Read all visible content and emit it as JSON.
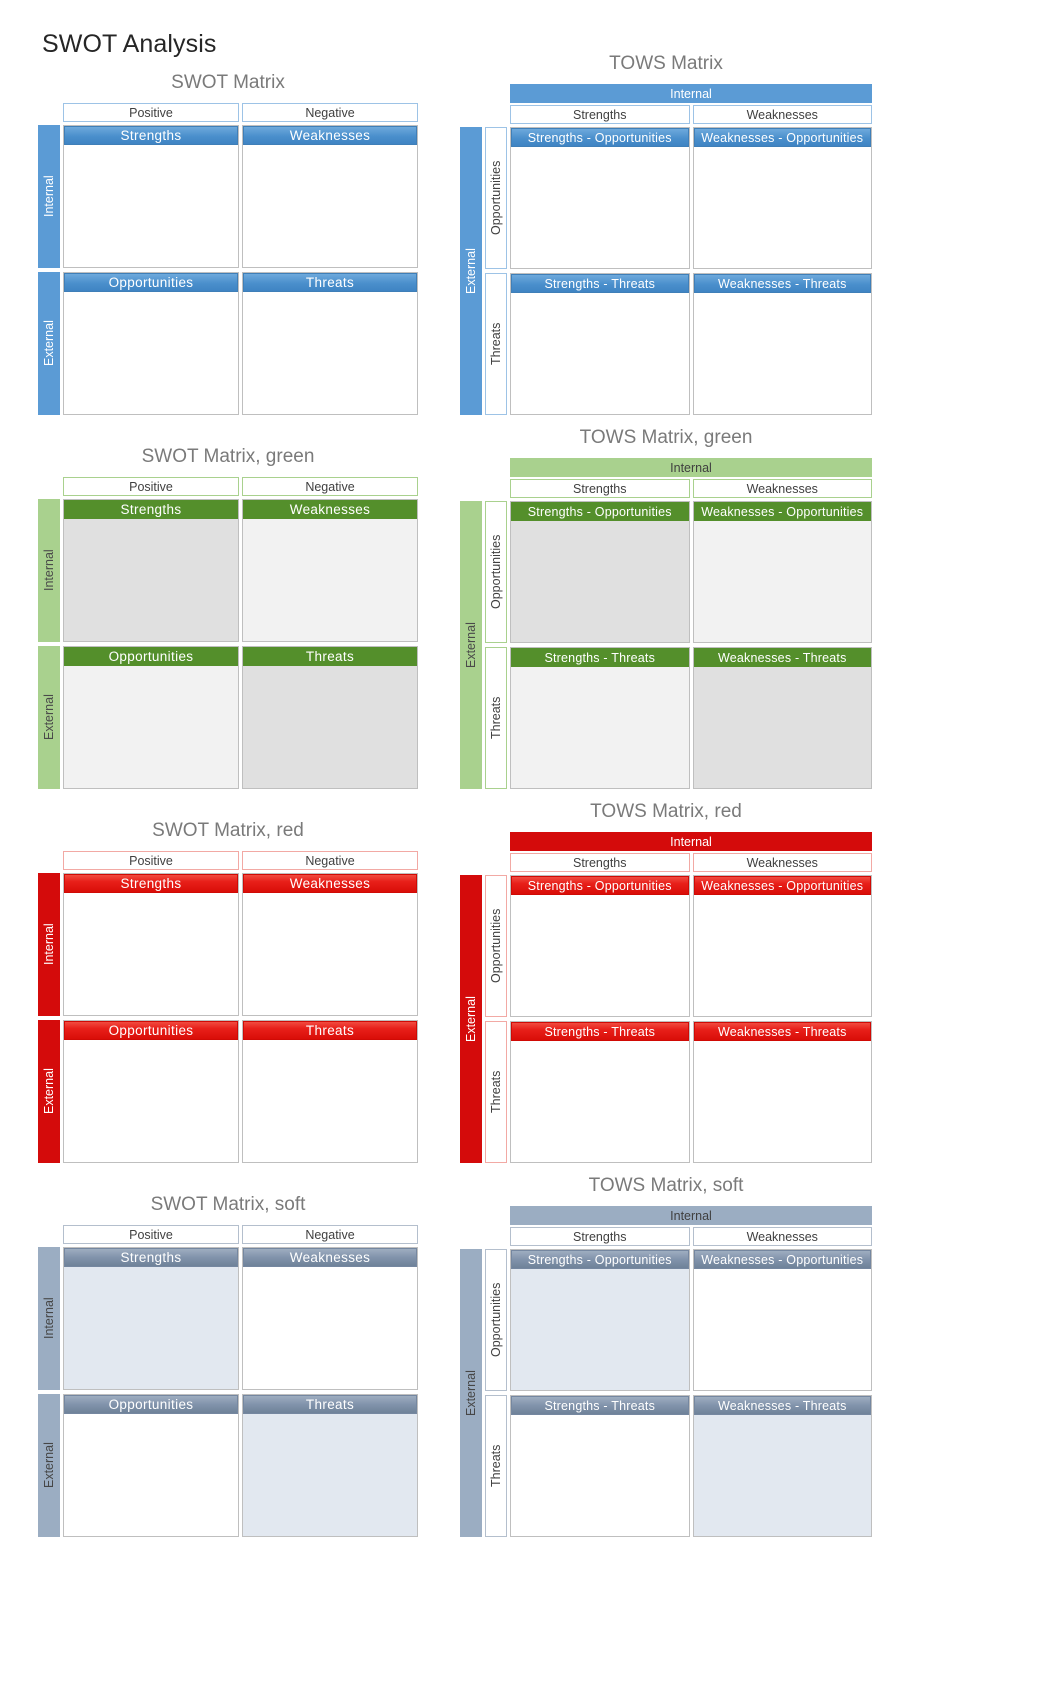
{
  "page": {
    "title": "SWOT Analysis"
  },
  "labels": {
    "positive": "Positive",
    "negative": "Negative",
    "internal": "Internal",
    "external": "External",
    "strengths": "Strengths",
    "weaknesses": "Weaknesses",
    "opportunities": "Opportunities",
    "threats": "Threats",
    "so": "Strengths - Opportunities",
    "wo": "Weaknesses - Opportunities",
    "st": "Strengths - Threats",
    "wt": "Weaknesses - Threats"
  },
  "colors": {
    "blue_accent": "#5B9BD5",
    "blue_header": "#3F84C3",
    "blue_border": "#9DC3E6",
    "green_accent": "#A9D18E",
    "green_header": "#548F2B",
    "red_accent": "#D40B0B",
    "red_header": "#E8201A",
    "soft_accent": "#9BADC2",
    "soft_header": "#8193AB",
    "fill_dark": "#E0E0E0",
    "fill_light": "#F2F2F2",
    "fill_soft": "#E2E8F0",
    "title_gray": "#7A7A7A",
    "text_gray": "#404040"
  },
  "matrices": {
    "swot_blue": {
      "title": "SWOT Matrix",
      "theme": "blue",
      "col_headers": [
        "Positive",
        "Negative"
      ],
      "row_headers": [
        "Internal",
        "External"
      ],
      "quadrants": [
        {
          "label": "Strengths",
          "fill": "none"
        },
        {
          "label": "Weaknesses",
          "fill": "none"
        },
        {
          "label": "Opportunities",
          "fill": "none"
        },
        {
          "label": "Threats",
          "fill": "none"
        }
      ]
    },
    "tows_blue": {
      "title": "TOWS Matrix",
      "theme": "blue",
      "top_bar": "Internal",
      "col_headers": [
        "Strengths",
        "Weaknesses"
      ],
      "outer_row_header": "External",
      "inner_row_headers": [
        "Opportunities",
        "Threats"
      ],
      "quadrants": [
        {
          "label": "Strengths - Opportunities",
          "fill": "none"
        },
        {
          "label": "Weaknesses - Opportunities",
          "fill": "none"
        },
        {
          "label": "Strengths - Threats",
          "fill": "none"
        },
        {
          "label": "Weaknesses - Threats",
          "fill": "none"
        }
      ]
    },
    "swot_green": {
      "title": "SWOT Matrix, green",
      "theme": "green",
      "col_headers": [
        "Positive",
        "Negative"
      ],
      "row_headers": [
        "Internal",
        "External"
      ],
      "quadrants": [
        {
          "label": "Strengths",
          "fill": "dark"
        },
        {
          "label": "Weaknesses",
          "fill": "light"
        },
        {
          "label": "Opportunities",
          "fill": "light"
        },
        {
          "label": "Threats",
          "fill": "dark"
        }
      ]
    },
    "tows_green": {
      "title": "TOWS Matrix, green",
      "theme": "green",
      "top_bar": "Internal",
      "col_headers": [
        "Strengths",
        "Weaknesses"
      ],
      "outer_row_header": "External",
      "inner_row_headers": [
        "Opportunities",
        "Threats"
      ],
      "quadrants": [
        {
          "label": "Strengths - Opportunities",
          "fill": "dark"
        },
        {
          "label": "Weaknesses - Opportunities",
          "fill": "light"
        },
        {
          "label": "Strengths - Threats",
          "fill": "light"
        },
        {
          "label": "Weaknesses - Threats",
          "fill": "dark"
        }
      ]
    },
    "swot_red": {
      "title": "SWOT Matrix, red",
      "theme": "red",
      "col_headers": [
        "Positive",
        "Negative"
      ],
      "row_headers": [
        "Internal",
        "External"
      ],
      "quadrants": [
        {
          "label": "Strengths",
          "fill": "none"
        },
        {
          "label": "Weaknesses",
          "fill": "none"
        },
        {
          "label": "Opportunities",
          "fill": "none"
        },
        {
          "label": "Threats",
          "fill": "none"
        }
      ]
    },
    "tows_red": {
      "title": "TOWS Matrix, red",
      "theme": "red",
      "top_bar": "Internal",
      "col_headers": [
        "Strengths",
        "Weaknesses"
      ],
      "outer_row_header": "External",
      "inner_row_headers": [
        "Opportunities",
        "Threats"
      ],
      "quadrants": [
        {
          "label": "Strengths - Opportunities",
          "fill": "none"
        },
        {
          "label": "Weaknesses - Opportunities",
          "fill": "none"
        },
        {
          "label": "Strengths - Threats",
          "fill": "none"
        },
        {
          "label": "Weaknesses - Threats",
          "fill": "none"
        }
      ]
    },
    "swot_soft": {
      "title": "SWOT Matrix, soft",
      "theme": "soft",
      "col_headers": [
        "Positive",
        "Negative"
      ],
      "row_headers": [
        "Internal",
        "External"
      ],
      "quadrants": [
        {
          "label": "Strengths",
          "fill": "soft"
        },
        {
          "label": "Weaknesses",
          "fill": "none"
        },
        {
          "label": "Opportunities",
          "fill": "none"
        },
        {
          "label": "Threats",
          "fill": "soft"
        }
      ]
    },
    "tows_soft": {
      "title": "TOWS Matrix, soft",
      "theme": "soft",
      "top_bar": "Internal",
      "col_headers": [
        "Strengths",
        "Weaknesses"
      ],
      "outer_row_header": "External",
      "inner_row_headers": [
        "Opportunities",
        "Threats"
      ],
      "quadrants": [
        {
          "label": "Strengths - Opportunities",
          "fill": "soft"
        },
        {
          "label": "Weaknesses - Opportunities",
          "fill": "none"
        },
        {
          "label": "Strengths - Threats",
          "fill": "none"
        },
        {
          "label": "Weaknesses - Threats",
          "fill": "soft"
        }
      ]
    }
  }
}
